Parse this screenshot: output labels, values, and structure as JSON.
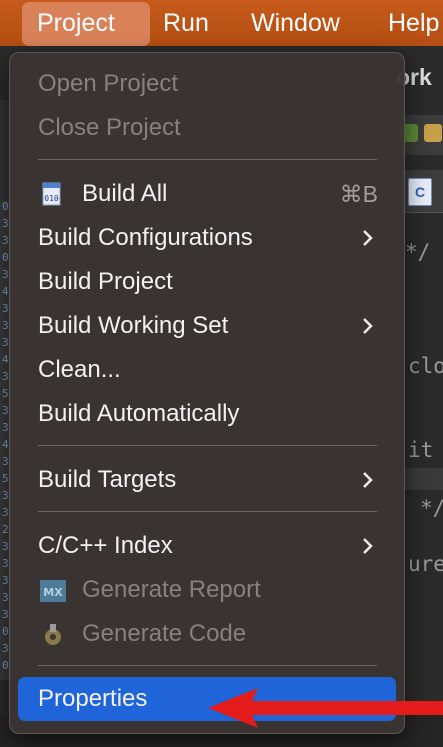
{
  "menubar": {
    "items": [
      "Project",
      "Run",
      "Window",
      "Help"
    ]
  },
  "background": {
    "title_fragment": "ork",
    "code_fragments": [
      "*/",
      "clo",
      "it",
      "*/",
      "ure"
    ],
    "gutter_digits": [
      "0",
      "3",
      "3",
      "0",
      "3",
      "4",
      "3",
      "3",
      "3",
      "4",
      "3",
      "5",
      "3",
      "3",
      "4",
      "3",
      "5",
      "3",
      "3",
      "2",
      "3",
      "3",
      "3",
      "3",
      "3",
      "0",
      "3",
      "0"
    ],
    "file_tab_icon": "C"
  },
  "menu": {
    "open_project": "Open Project",
    "close_project": "Close Project",
    "build_all": "Build All",
    "build_all_shortcut": "⌘B",
    "build_configurations": "Build Configurations",
    "build_project": "Build Project",
    "build_working_set": "Build Working Set",
    "clean": "Clean...",
    "build_automatically": "Build Automatically",
    "build_targets": "Build Targets",
    "cpp_index": "C/C++ Index",
    "generate_report": "Generate Report",
    "generate_report_icon_text": "MX",
    "generate_code": "Generate Code",
    "properties": "Properties"
  },
  "colors": {
    "menubar": "#b44e12",
    "selection": "#1f64d8",
    "annotation_arrow": "#e31b1b"
  }
}
